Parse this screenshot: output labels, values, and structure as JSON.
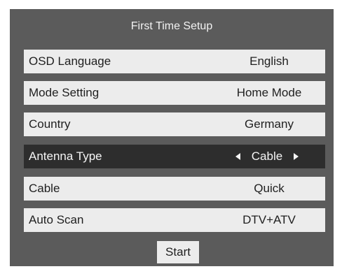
{
  "dialog": {
    "title": "First Time Setup",
    "start_label": "Start"
  },
  "settings": [
    {
      "label": "OSD Language",
      "value": "English"
    },
    {
      "label": "Mode Setting",
      "value": "Home Mode"
    },
    {
      "label": "Country",
      "value": "Germany"
    },
    {
      "label": "Antenna Type",
      "value": "Cable",
      "selected": true
    },
    {
      "label": "Cable",
      "value": "Quick"
    },
    {
      "label": "Auto Scan",
      "value": "DTV+ATV"
    }
  ],
  "icons": {
    "left": "arrow-left-icon",
    "right": "arrow-right-icon"
  }
}
